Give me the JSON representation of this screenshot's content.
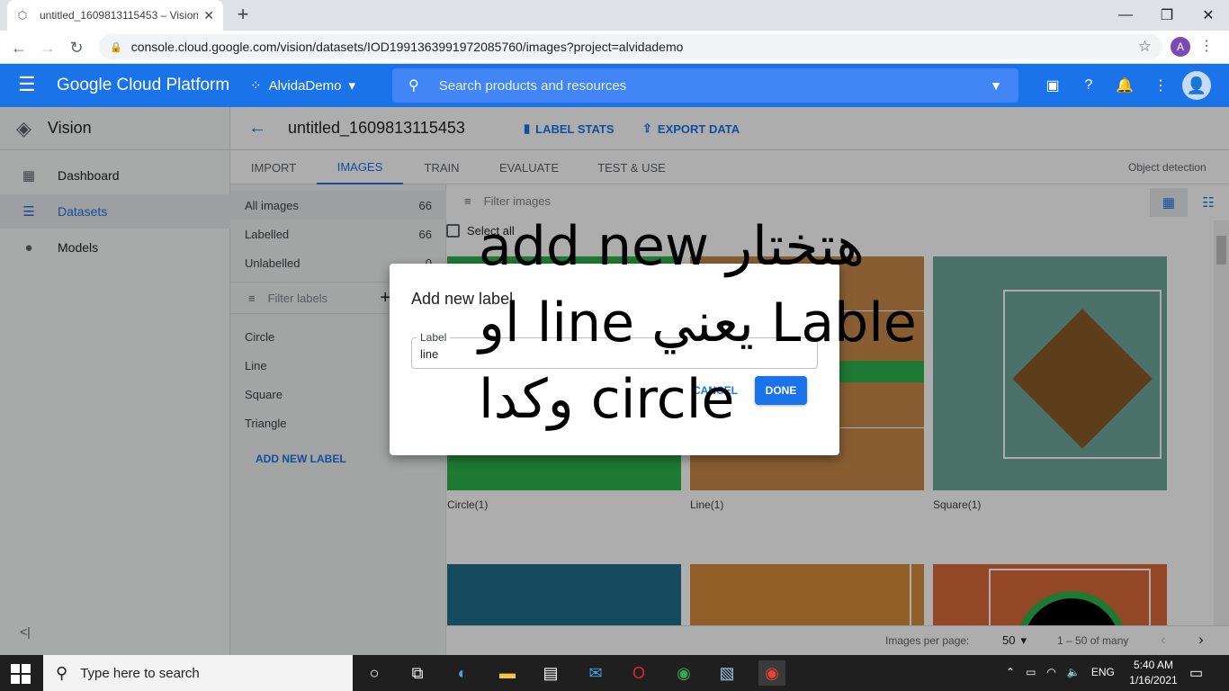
{
  "browser": {
    "tab_title": "untitled_1609813115453 – Vision",
    "url": "console.cloud.google.com/vision/datasets/IOD1991363991972085760/images?project=alvidademo",
    "profile_initial": "A"
  },
  "gcp": {
    "brand": "Google Cloud Platform",
    "project": "AlvidaDemo",
    "search_placeholder": "Search products and resources"
  },
  "sidebar": {
    "product": "Vision",
    "items": [
      {
        "label": "Dashboard",
        "icon": "dashboard-icon"
      },
      {
        "label": "Datasets",
        "icon": "list-icon"
      },
      {
        "label": "Models",
        "icon": "lightbulb-icon"
      }
    ]
  },
  "header": {
    "dataset_title": "untitled_1609813115453",
    "label_stats": "LABEL STATS",
    "export_data": "EXPORT DATA"
  },
  "tabs": [
    {
      "label": "IMPORT"
    },
    {
      "label": "IMAGES"
    },
    {
      "label": "TRAIN"
    },
    {
      "label": "EVALUATE"
    },
    {
      "label": "TEST & USE"
    }
  ],
  "object_detection": "Object detection",
  "filters": {
    "rows": [
      {
        "label": "All images",
        "count": "66"
      },
      {
        "label": "Labelled",
        "count": "66"
      },
      {
        "label": "Unlabelled",
        "count": "0"
      }
    ],
    "filter_labels_placeholder": "Filter labels",
    "labels": [
      "Circle",
      "Line",
      "Square",
      "Triangle"
    ],
    "add_new_label": "ADD NEW LABEL"
  },
  "grid": {
    "filter_images_placeholder": "Filter images",
    "select_all": "Select all",
    "captions": [
      "Circle(1)",
      "Line(1)",
      "Square(1)"
    ]
  },
  "pager": {
    "per_page_label": "Images per page:",
    "per_page_value": "50",
    "range": "1 – 50 of many"
  },
  "dialog": {
    "title": "Add new label",
    "field_label": "Label",
    "field_value": "line",
    "cancel": "CANCEL",
    "done": "DONE"
  },
  "annotation": {
    "line1": "add new  هتختار",
    "line2": "او line يعني Lable",
    "line3": "وكدا circle"
  },
  "taskbar": {
    "search_placeholder": "Type here to search",
    "lang": "ENG",
    "time": "5:40 AM",
    "date": "1/16/2021"
  },
  "colors": {
    "gcp_blue": "#1a73e8",
    "circle_green": "#2db34a",
    "line_orange": "#c98a4b",
    "square_teal": "#6fa89a",
    "diamond_brown": "#8b5a2b"
  }
}
